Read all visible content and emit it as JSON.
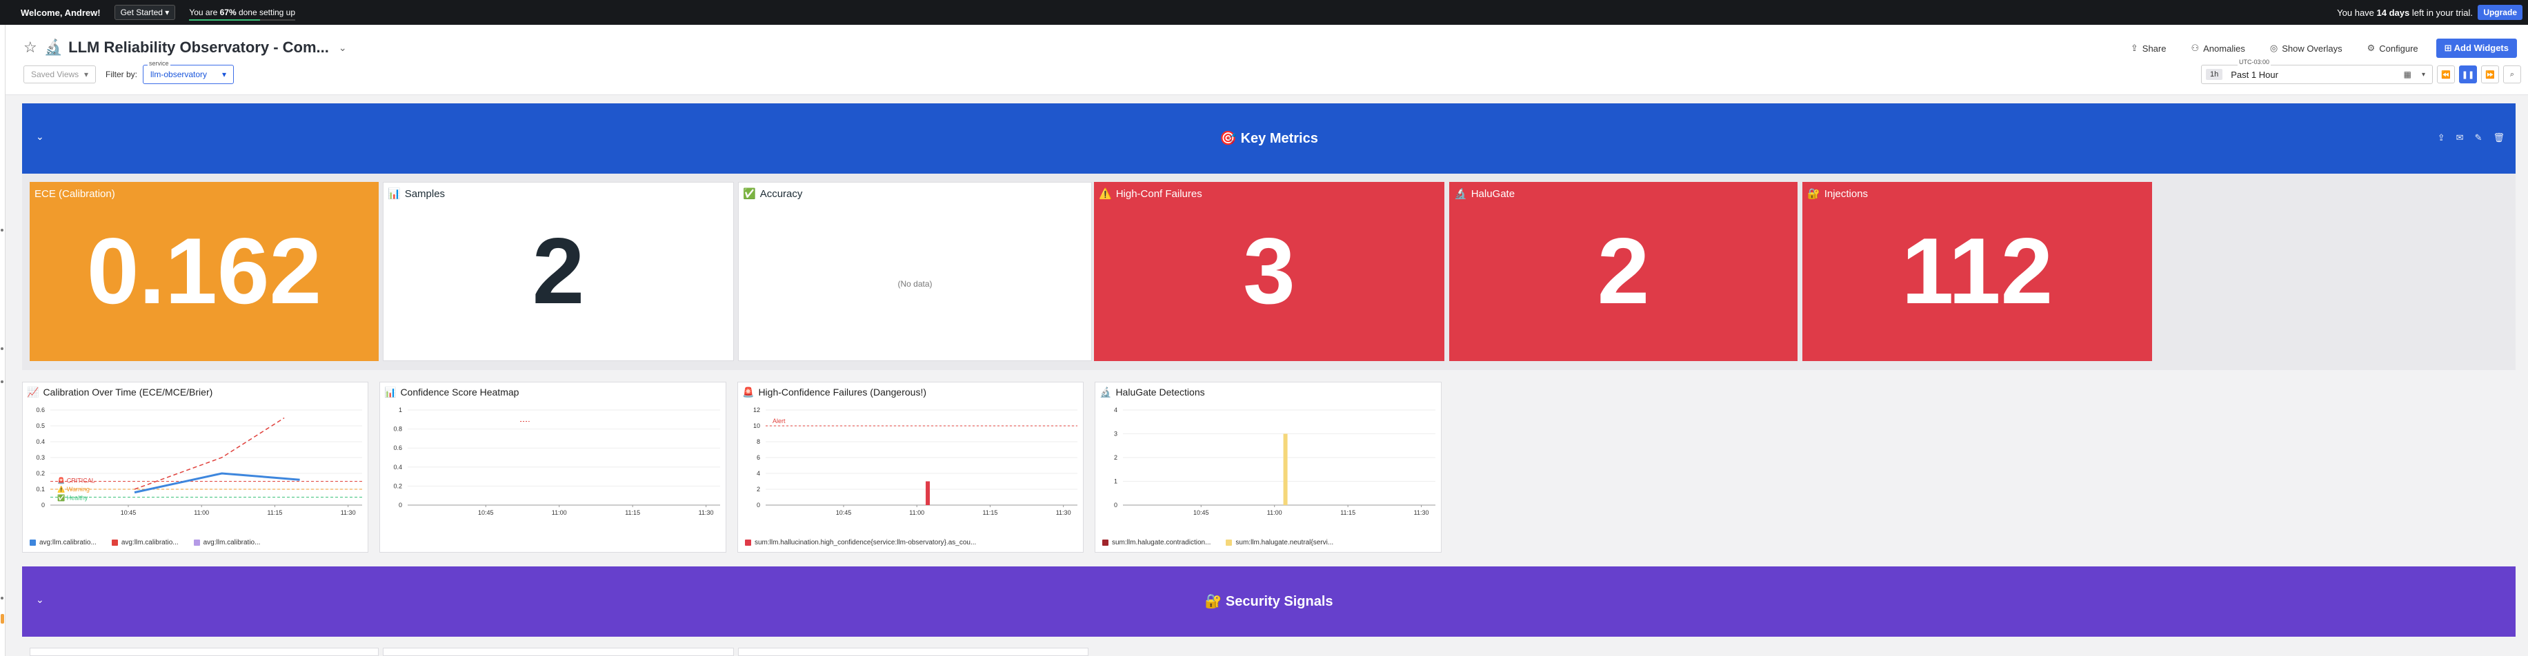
{
  "topbar": {
    "welcome": "Welcome, Andrew!",
    "get_started": "Get Started",
    "setup_prefix": "You are ",
    "setup_percent": "67%",
    "setup_suffix": " done setting up",
    "setup_progress": 0.67,
    "trial_prefix": "You have ",
    "trial_days": "14 days",
    "trial_suffix": " left in your trial.",
    "upgrade": "Upgrade"
  },
  "header": {
    "title": "LLM Reliability Observatory - Com...",
    "title_emoji": "🔬",
    "saved_views": "Saved Views",
    "filter_by": "Filter by:",
    "service_label": "service",
    "service_value": "llm-observatory",
    "actions": {
      "share": "Share",
      "anomalies": "Anomalies",
      "overlays": "Show Overlays",
      "configure": "Configure",
      "add_widgets": "Add Widgets"
    },
    "time": {
      "tz": "UTC-03:00",
      "duration": "1h",
      "range": "Past 1 Hour"
    }
  },
  "groups": {
    "key_metrics": {
      "title": "🎯 Key Metrics",
      "color": "#1f57cc"
    },
    "security": {
      "title": "🔐 Security Signals",
      "color": "#6640cc"
    }
  },
  "query_values": [
    {
      "icon": "",
      "title": "ECE (Calibration)",
      "value": "0.162",
      "style": "orange"
    },
    {
      "icon": "📊",
      "title": "Samples",
      "value": "2",
      "style": "white"
    },
    {
      "icon": "✅",
      "title": "Accuracy",
      "value": "",
      "nodata": "(No data)",
      "style": "white"
    },
    {
      "icon": "⚠️",
      "title": "High-Conf Failures",
      "value": "3",
      "style": "red"
    },
    {
      "icon": "🔬",
      "title": "HaluGate",
      "value": "2",
      "style": "red"
    },
    {
      "icon": "🔐",
      "title": "Injections",
      "value": "112",
      "style": "red"
    }
  ],
  "timeseries": [
    {
      "icon": "📈",
      "title": "Calibration Over Time (ECE/MCE/Brier)",
      "legend": [
        {
          "name": "avg:llm.calibratio...",
          "color": "#3d86dd"
        },
        {
          "name": "avg:llm.calibratio...",
          "color": "#e0413c"
        },
        {
          "name": "avg:llm.calibratio...",
          "color": "#b59ae6"
        }
      ],
      "markers": [
        "🚨 CRITICAL",
        "⚠️ Warning",
        "✅ Healthy"
      ]
    },
    {
      "icon": "📊",
      "title": "Confidence Score Heatmap",
      "legend": []
    },
    {
      "icon": "🚨",
      "title": "High-Confidence Failures (Dangerous!)",
      "alert": "Alert",
      "legend": [
        {
          "name": "sum:llm.hallucination.high_confidence{service:llm-observatory}.as_cou...",
          "color": "#df3b48"
        }
      ]
    },
    {
      "icon": "🔬",
      "title": "HaluGate Detections",
      "legend": [
        {
          "name": "sum:llm.halugate.contradiction...",
          "color": "#a0252c"
        },
        {
          "name": "sum:llm.halugate.neutral{servi...",
          "color": "#f5d77a"
        }
      ]
    }
  ],
  "chart_data": [
    {
      "type": "line",
      "title": "Calibration Over Time (ECE/MCE/Brier)",
      "x": [
        "10:45",
        "11:00",
        "11:15",
        "11:30"
      ],
      "ylim": [
        0,
        0.6
      ],
      "yticks": [
        0,
        0.1,
        0.2,
        0.3,
        0.4,
        0.5,
        0.6
      ],
      "series": [
        {
          "name": "avg:llm.calibratio...",
          "color": "#3d86dd",
          "points": [
            [
              0.27,
              0.08
            ],
            [
              0.55,
              0.2
            ],
            [
              0.8,
              0.16
            ]
          ]
        },
        {
          "name": "avg:llm.calibratio...",
          "color": "#e0413c",
          "points": [
            [
              0.27,
              0.1
            ],
            [
              0.55,
              0.3
            ],
            [
              0.75,
              0.55
            ]
          ]
        },
        {
          "name": "avg:llm.calibratio...",
          "color": "#b59ae6",
          "points": []
        }
      ],
      "thresholds": [
        {
          "value": 0.15,
          "color": "#e0413c"
        },
        {
          "value": 0.1,
          "color": "#f19b2c"
        },
        {
          "value": 0.05,
          "color": "#3ac27a"
        }
      ]
    },
    {
      "type": "heatmap",
      "title": "Confidence Score Heatmap",
      "x": [
        "10:45",
        "11:00",
        "11:15",
        "11:30"
      ],
      "ylim": [
        0,
        1
      ],
      "yticks": [
        0,
        0.2,
        0.4,
        0.6,
        0.8,
        1
      ]
    },
    {
      "type": "bar",
      "title": "High-Confidence Failures (Dangerous!)",
      "x": [
        "10:45",
        "11:00",
        "11:15",
        "11:30"
      ],
      "ylim": [
        0,
        12
      ],
      "yticks": [
        0,
        2,
        4,
        6,
        8,
        10,
        12
      ],
      "alert_threshold": 10,
      "bars": [
        {
          "x": 0.52,
          "value": 3,
          "color": "#df3b48"
        }
      ]
    },
    {
      "type": "bar",
      "title": "HaluGate Detections",
      "x": [
        "10:45",
        "11:00",
        "11:15",
        "11:30"
      ],
      "ylim": [
        0,
        4
      ],
      "yticks": [
        0,
        1,
        2,
        3,
        4
      ],
      "bars": [
        {
          "x": 0.52,
          "value": 3,
          "color": "#f5d77a"
        }
      ]
    }
  ]
}
